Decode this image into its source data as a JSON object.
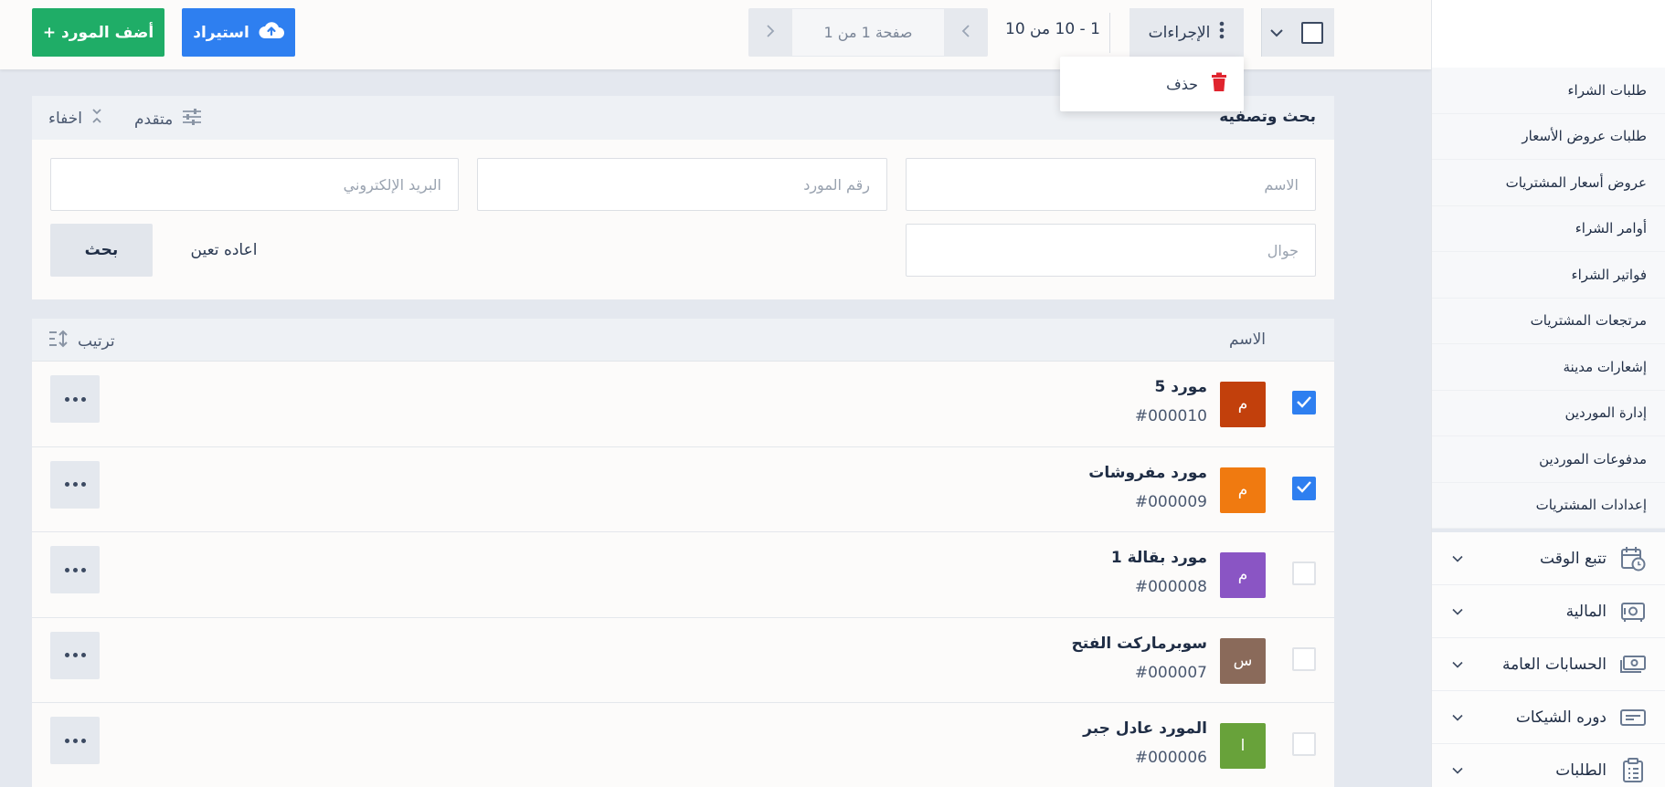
{
  "header": {
    "add_supplier": "+ أضف المورد",
    "import": "استيراد",
    "pager_text": "صفحة 1 من 1",
    "range_text": "1 - 10 من 10",
    "actions": "الإجراءات",
    "dropdown": {
      "delete": "حذف"
    }
  },
  "search": {
    "title": "بحث وتصفيه",
    "advanced": "متقدم",
    "hide": "اخفاء",
    "name_placeholder": "الاسم",
    "supplier_no_placeholder": "رقم المورد",
    "email_placeholder": "البريد الإلكتروني",
    "mobile_placeholder": "جوال",
    "search_button": "بحث",
    "reset_button": "اعاده تعين"
  },
  "list": {
    "name_header": "الاسم",
    "sort_label": "ترتيب",
    "rows": [
      {
        "name": "مورد 5",
        "code": "#000010",
        "initial": "م",
        "color": "#c2400c",
        "checked": true
      },
      {
        "name": "مورد مفروشات",
        "code": "#000009",
        "initial": "م",
        "color": "#f07a10",
        "checked": true
      },
      {
        "name": "مورد بقالة 1",
        "code": "#000008",
        "initial": "م",
        "color": "#8a55c4",
        "checked": false
      },
      {
        "name": "سوبرماركت الفتح",
        "code": "#000007",
        "initial": "س",
        "color": "#8a6a5a",
        "checked": false
      },
      {
        "name": "المورد عادل جبر",
        "code": "#000006",
        "initial": "ا",
        "color": "#68a23a",
        "checked": false
      }
    ]
  },
  "sidebar": {
    "sub_items": [
      {
        "label": "طلبات الشراء"
      },
      {
        "label": "طلبات عروض الأسعار"
      },
      {
        "label": "عروض أسعار المشتريات"
      },
      {
        "label": "أوامر الشراء"
      },
      {
        "label": "فواتير الشراء"
      },
      {
        "label": "مرتجعات المشتريات"
      },
      {
        "label": "إشعارات مدينة"
      },
      {
        "label": "إدارة الموردين"
      },
      {
        "label": "مدفوعات الموردين"
      },
      {
        "label": "إعدادات المشتريات"
      }
    ],
    "main_items": [
      {
        "label": "تتبع الوقت",
        "icon": "calendar-clock-icon"
      },
      {
        "label": "المالية",
        "icon": "safe-icon"
      },
      {
        "label": "الحسابات العامة",
        "icon": "money-icon"
      },
      {
        "label": "دوره الشيكات",
        "icon": "check-card-icon"
      },
      {
        "label": "الطلبات",
        "icon": "clipboard-icon"
      }
    ]
  },
  "colors": {
    "primary_green": "#1fad67",
    "primary_blue": "#2e7ff0",
    "delete_red": "#e0242e"
  }
}
